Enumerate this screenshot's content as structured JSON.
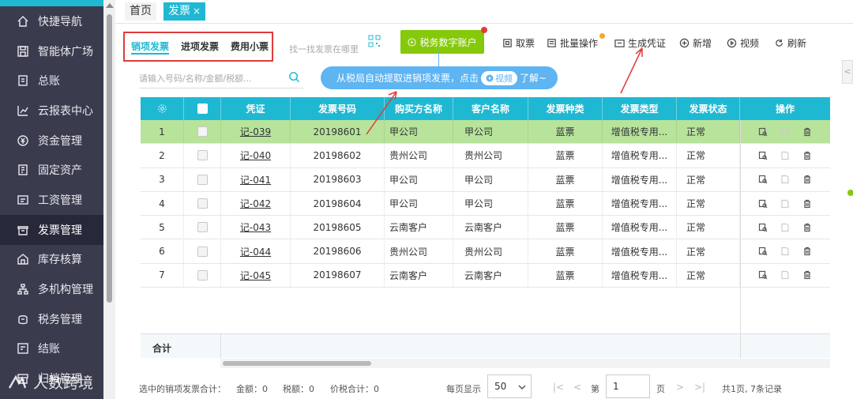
{
  "sidebar": {
    "items": [
      {
        "label": "快捷导航",
        "icon": "home-icon"
      },
      {
        "label": "智能体广场",
        "icon": "save-icon"
      },
      {
        "label": "总账",
        "icon": "ledger-icon"
      },
      {
        "label": "云报表中心",
        "icon": "chart-icon"
      },
      {
        "label": "资金管理",
        "icon": "money-icon"
      },
      {
        "label": "固定资产",
        "icon": "asset-icon"
      },
      {
        "label": "工资管理",
        "icon": "salary-icon"
      },
      {
        "label": "发票管理",
        "icon": "invoice-icon"
      },
      {
        "label": "库存核算",
        "icon": "warehouse-icon"
      },
      {
        "label": "多机构管理",
        "icon": "org-icon"
      },
      {
        "label": "税务管理",
        "icon": "tax-icon"
      },
      {
        "label": "结账",
        "icon": "checkout-icon"
      },
      {
        "label": "归档管理",
        "icon": "archive-icon"
      }
    ],
    "watermark": "人数跨境"
  },
  "tabs": {
    "home": "首页",
    "invoice": "发票",
    "close": "×"
  },
  "subtabs": {
    "sales": "销项发票",
    "purchase": "进项发票",
    "expense": "费用小票"
  },
  "toolbar": {
    "find_hint": "找一找发票在哪里",
    "tax_account": "税务数字账户",
    "fetch": "取票",
    "batch": "批量操作",
    "gen_voucher": "生成凭证",
    "add": "新增",
    "video": "视频",
    "refresh": "刷新"
  },
  "search": {
    "placeholder": "请输入号码/名称/金额/税额..."
  },
  "tip": {
    "text": "从税局自动提取进销项发票，点击",
    "video": "视频",
    "more": "了解~"
  },
  "table": {
    "headers": [
      "凭证",
      "发票号码",
      "购买方名称",
      "客户名称",
      "发票种类",
      "发票类型",
      "发票状态",
      "操作"
    ],
    "rows": [
      {
        "no": "1",
        "voucher": "记-039",
        "number": "20198601",
        "buyer": "甲公司",
        "client": "甲公司",
        "kind": "蓝票",
        "type": "增值税专用...",
        "status": "正常"
      },
      {
        "no": "2",
        "voucher": "记-040",
        "number": "20198602",
        "buyer": "贵州公司",
        "client": "贵州公司",
        "kind": "蓝票",
        "type": "增值税专用...",
        "status": "正常"
      },
      {
        "no": "3",
        "voucher": "记-041",
        "number": "20198603",
        "buyer": "甲公司",
        "client": "甲公司",
        "kind": "蓝票",
        "type": "增值税专用...",
        "status": "正常"
      },
      {
        "no": "4",
        "voucher": "记-042",
        "number": "20198604",
        "buyer": "甲公司",
        "client": "甲公司",
        "kind": "蓝票",
        "type": "增值税专用...",
        "status": "正常"
      },
      {
        "no": "5",
        "voucher": "记-043",
        "number": "20198605",
        "buyer": "云南客户",
        "client": "云南客户",
        "kind": "蓝票",
        "type": "增值税专用...",
        "status": "正常"
      },
      {
        "no": "6",
        "voucher": "记-044",
        "number": "20198606",
        "buyer": "贵州公司",
        "client": "贵州公司",
        "kind": "蓝票",
        "type": "增值税专用...",
        "status": "正常"
      },
      {
        "no": "7",
        "voucher": "记-045",
        "number": "20198607",
        "buyer": "云南客户",
        "client": "云南客户",
        "kind": "蓝票",
        "type": "增值税专用...",
        "status": "正常"
      }
    ],
    "sum_label": "合计"
  },
  "footer": {
    "selected": "选中的销项发票合计：",
    "amount": "金额：0",
    "tax": "税额：0",
    "total": "价税合计：0",
    "per_page_label": "每页显示",
    "per_page": "50",
    "page_prefix": "第",
    "page": "1",
    "page_suffix": "页",
    "summary": "共1页, 7条记录"
  },
  "colors": {
    "accent": "#1fb8d3",
    "green": "#86c90a",
    "selected_row": "#b7e39b",
    "highlight": "#e23a3a"
  }
}
